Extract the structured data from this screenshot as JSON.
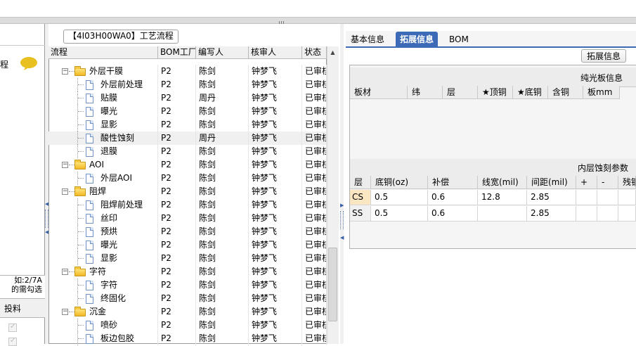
{
  "left_panel": {
    "title": "程",
    "hint_lines": [
      "如:2/7A",
      "的需勾选"
    ],
    "grid_column": "投料"
  },
  "mid_panel": {
    "title": "【4I03H00WA0】工艺流程",
    "columns": [
      "流程",
      "BOM工厂",
      "编写人",
      "核审人",
      "状态"
    ],
    "rows": [
      {
        "level": 1,
        "type": "folder",
        "name": "外层干膜",
        "bom": "P2",
        "writer": "陈剑",
        "reviewer": "钟梦飞",
        "status": "已审核"
      },
      {
        "level": 2,
        "type": "doc",
        "name": "外层前处理",
        "bom": "P2",
        "writer": "陈剑",
        "reviewer": "钟梦飞",
        "status": "已审核"
      },
      {
        "level": 2,
        "type": "doc",
        "name": "贴膜",
        "bom": "P2",
        "writer": "周丹",
        "reviewer": "钟梦飞",
        "status": "已审核"
      },
      {
        "level": 2,
        "type": "doc",
        "name": "曝光",
        "bom": "P2",
        "writer": "陈剑",
        "reviewer": "钟梦飞",
        "status": "已审核"
      },
      {
        "level": 2,
        "type": "doc",
        "name": "显影",
        "bom": "P2",
        "writer": "陈剑",
        "reviewer": "钟梦飞",
        "status": "已审核"
      },
      {
        "level": 2,
        "type": "doc",
        "name": "酸性蚀刻",
        "bom": "P2",
        "writer": "周丹",
        "reviewer": "钟梦飞",
        "status": "已审核",
        "selected": true
      },
      {
        "level": 2,
        "type": "doc",
        "name": "退膜",
        "bom": "P2",
        "writer": "陈剑",
        "reviewer": "钟梦飞",
        "status": "已审核"
      },
      {
        "level": 1,
        "type": "folder",
        "name": "AOI",
        "bom": "P2",
        "writer": "陈剑",
        "reviewer": "钟梦飞",
        "status": "已审核"
      },
      {
        "level": 2,
        "type": "doc",
        "name": "外层AOI",
        "bom": "P2",
        "writer": "陈剑",
        "reviewer": "钟梦飞",
        "status": "已审核"
      },
      {
        "level": 1,
        "type": "folder",
        "name": "阻焊",
        "bom": "P2",
        "writer": "陈剑",
        "reviewer": "钟梦飞",
        "status": "已审核"
      },
      {
        "level": 2,
        "type": "doc",
        "name": "阻焊前处理",
        "bom": "P2",
        "writer": "陈剑",
        "reviewer": "钟梦飞",
        "status": "已审核"
      },
      {
        "level": 2,
        "type": "doc",
        "name": "丝印",
        "bom": "P2",
        "writer": "陈剑",
        "reviewer": "钟梦飞",
        "status": "已审核"
      },
      {
        "level": 2,
        "type": "doc",
        "name": "预烘",
        "bom": "P2",
        "writer": "陈剑",
        "reviewer": "钟梦飞",
        "status": "已审核"
      },
      {
        "level": 2,
        "type": "doc",
        "name": "曝光",
        "bom": "P2",
        "writer": "陈剑",
        "reviewer": "钟梦飞",
        "status": "已审核"
      },
      {
        "level": 2,
        "type": "doc",
        "name": "显影",
        "bom": "P2",
        "writer": "陈剑",
        "reviewer": "钟梦飞",
        "status": "已审核"
      },
      {
        "level": 1,
        "type": "folder",
        "name": "字符",
        "bom": "P2",
        "writer": "陈剑",
        "reviewer": "钟梦飞",
        "status": "已审核"
      },
      {
        "level": 2,
        "type": "doc",
        "name": "字符",
        "bom": "P2",
        "writer": "陈剑",
        "reviewer": "钟梦飞",
        "status": "已审核"
      },
      {
        "level": 2,
        "type": "doc",
        "name": "终固化",
        "bom": "P2",
        "writer": "陈剑",
        "reviewer": "钟梦飞",
        "status": "已审核"
      },
      {
        "level": 1,
        "type": "folder",
        "name": "沉金",
        "bom": "P2",
        "writer": "陈剑",
        "reviewer": "钟梦飞",
        "status": "已审核"
      },
      {
        "level": 2,
        "type": "doc",
        "name": "喷砂",
        "bom": "P2",
        "writer": "陈剑",
        "reviewer": "钟梦飞",
        "status": "已审核"
      },
      {
        "level": 2,
        "type": "doc",
        "name": "板边包胶",
        "bom": "P2",
        "writer": "陈剑",
        "reviewer": "钟梦飞",
        "status": "已审核"
      }
    ]
  },
  "right_panel": {
    "tabs": [
      {
        "label": "基本信息",
        "active": false
      },
      {
        "label": "拓展信息",
        "active": true
      },
      {
        "label": "BOM",
        "active": false
      }
    ],
    "ext_button": "拓展信息",
    "section1": {
      "title": "纯光板信息",
      "columns": [
        "板材",
        "纬",
        "层",
        "★顶铜",
        "★底铜",
        "含铜",
        "板mm"
      ]
    },
    "section2": {
      "title": "内层蚀刻参数",
      "columns": [
        "层",
        "底铜(oz)",
        "补偿",
        "线宽(mil)",
        "间距(mil)",
        "+",
        "-",
        "残铜"
      ],
      "rows": [
        {
          "layer": "CS",
          "base": "0.5",
          "comp": "0.6",
          "width": "12.8",
          "spacing": "2.85",
          "plus": "",
          "minus": "",
          "residual": "",
          "highlight": true
        },
        {
          "layer": "SS",
          "base": "0.5",
          "comp": "0.6",
          "width": "",
          "spacing": "2.85",
          "plus": "",
          "minus": "",
          "residual": "",
          "highlight": false
        }
      ]
    }
  },
  "colors": {
    "accent": "#3c6ab6",
    "chat_icon": "#e8c020",
    "folder": "#f2b922"
  }
}
